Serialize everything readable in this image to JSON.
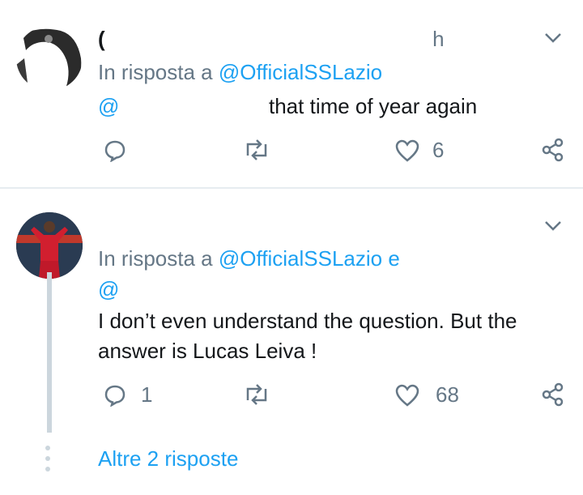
{
  "tweets": [
    {
      "header_fragment": "h",
      "reply_prefix": "In risposta a",
      "reply_handle": "@OfficialSSLazio",
      "mention": "@",
      "text": "that time of year again",
      "replies": "",
      "likes": "6"
    },
    {
      "reply_prefix": "In risposta a",
      "reply_handle": "@OfficialSSLazio e",
      "mention": "@",
      "text_line1": "I don’t even understand the question. But the",
      "text_line2": "answer is Lucas Leiva !",
      "replies": "1",
      "likes": "68"
    }
  ],
  "more_replies": "Altre 2 risposte",
  "colors": {
    "link": "#1da1f2",
    "muted": "#657786",
    "text": "#14171a",
    "divider": "#e6ecf0"
  },
  "icons": [
    "reply-icon",
    "retweet-icon",
    "like-icon",
    "share-icon",
    "chevron-down-icon"
  ]
}
